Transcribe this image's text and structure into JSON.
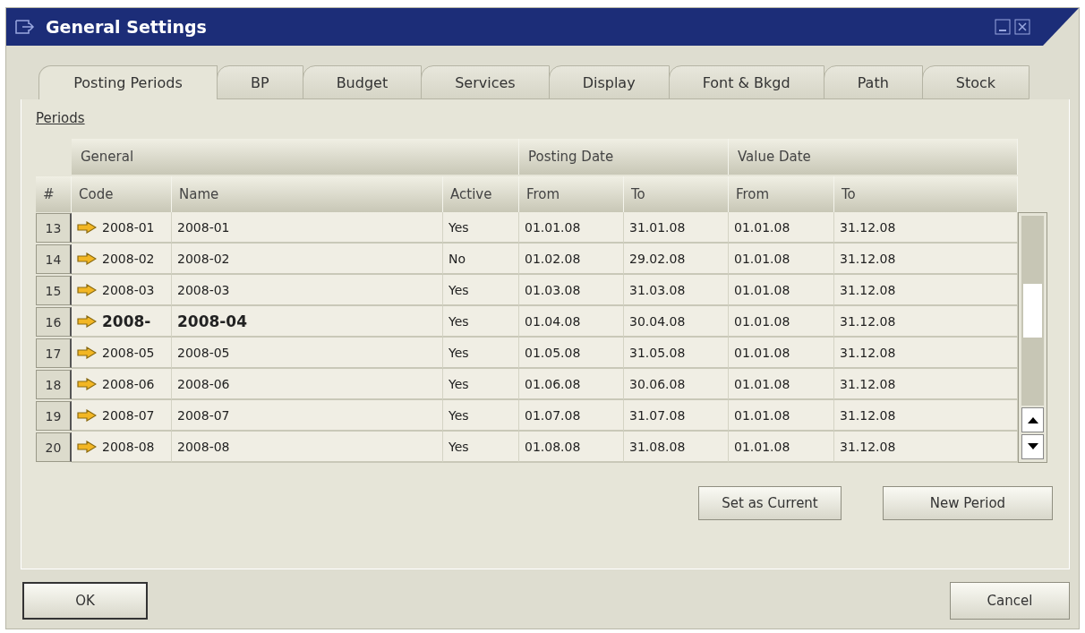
{
  "window": {
    "title": "General Settings"
  },
  "tabs": [
    {
      "label": "Posting Periods",
      "selected": true
    },
    {
      "label": "BP",
      "selected": false
    },
    {
      "label": "Budget",
      "selected": false
    },
    {
      "label": "Services",
      "selected": false
    },
    {
      "label": "Display",
      "selected": false
    },
    {
      "label": "Font & Bkgd",
      "selected": false
    },
    {
      "label": "Path",
      "selected": false
    },
    {
      "label": "Stock",
      "selected": false
    }
  ],
  "section_link": "Periods",
  "table": {
    "groups": [
      "General",
      "Posting Date",
      "Value Date"
    ],
    "columns": [
      "#",
      "Code",
      "Name",
      "Active",
      "From",
      "To",
      "From",
      "To"
    ],
    "rows": [
      {
        "num": "13",
        "code": "2008-01",
        "name": "2008-01",
        "active": "Yes",
        "posting_from": "01.01.08",
        "posting_to": "31.01.08",
        "value_from": "01.01.08",
        "value_to": "31.12.08",
        "current": false
      },
      {
        "num": "14",
        "code": "2008-02",
        "name": "2008-02",
        "active": "No",
        "posting_from": "01.02.08",
        "posting_to": "29.02.08",
        "value_from": "01.01.08",
        "value_to": "31.12.08",
        "current": false
      },
      {
        "num": "15",
        "code": "2008-03",
        "name": "2008-03",
        "active": "Yes",
        "posting_from": "01.03.08",
        "posting_to": "31.03.08",
        "value_from": "01.01.08",
        "value_to": "31.12.08",
        "current": false
      },
      {
        "num": "16",
        "code": "2008-",
        "name": "2008-04",
        "active": "Yes",
        "posting_from": "01.04.08",
        "posting_to": "30.04.08",
        "value_from": "01.01.08",
        "value_to": "31.12.08",
        "current": true
      },
      {
        "num": "17",
        "code": "2008-05",
        "name": "2008-05",
        "active": "Yes",
        "posting_from": "01.05.08",
        "posting_to": "31.05.08",
        "value_from": "01.01.08",
        "value_to": "31.12.08",
        "current": false
      },
      {
        "num": "18",
        "code": "2008-06",
        "name": "2008-06",
        "active": "Yes",
        "posting_from": "01.06.08",
        "posting_to": "30.06.08",
        "value_from": "01.01.08",
        "value_to": "31.12.08",
        "current": false
      },
      {
        "num": "19",
        "code": "2008-07",
        "name": "2008-07",
        "active": "Yes",
        "posting_from": "01.07.08",
        "posting_to": "31.07.08",
        "value_from": "01.01.08",
        "value_to": "31.12.08",
        "current": false
      },
      {
        "num": "20",
        "code": "2008-08",
        "name": "2008-08",
        "active": "Yes",
        "posting_from": "01.08.08",
        "posting_to": "31.08.08",
        "value_from": "01.01.08",
        "value_to": "31.12.08",
        "current": false
      }
    ]
  },
  "panel_buttons": [
    "Set as Current",
    "New Period"
  ],
  "footer_buttons": [
    "OK",
    "Cancel"
  ]
}
